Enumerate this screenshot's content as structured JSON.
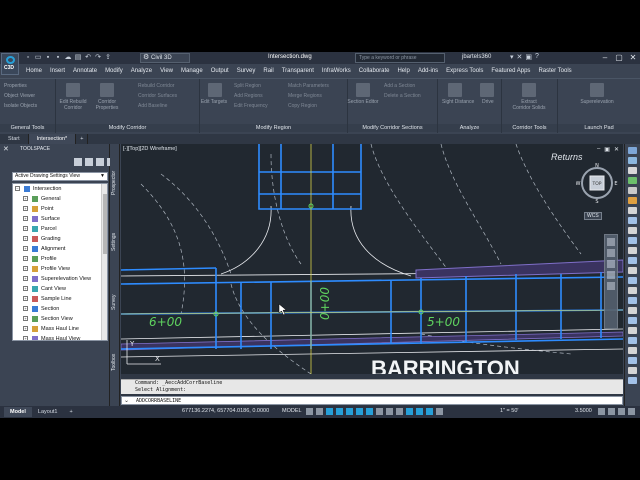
{
  "app": {
    "logo_text": "C3D",
    "workspace": "Civil 3D",
    "doc_title": "Intersection.dwg",
    "search_placeholder": "Type a keyword or phrase",
    "user": "jbartels360"
  },
  "menu": {
    "tabs": [
      "Home",
      "Insert",
      "Annotate",
      "Modify",
      "Analyze",
      "View",
      "Manage",
      "Output",
      "Survey",
      "Rail",
      "Transparent",
      "InfraWorks",
      "Collaborate",
      "Help",
      "Add-ins",
      "Express Tools",
      "Featured Apps",
      "Raster Tools"
    ]
  },
  "ribbon": {
    "general_tools": {
      "title": "General Tools",
      "items": [
        "Properties",
        "Object Viewer",
        "Isolate Objects"
      ]
    },
    "modify_corridor": {
      "title": "Modify Corridor",
      "big1": "Edit Rebuild Corridor",
      "big2": "Corridor Properties",
      "items": [
        "Rebuild Corridor",
        "Corridor Surfaces",
        "Add Baseline"
      ]
    },
    "modify_region": {
      "title": "Modify Region",
      "big1": "Edit Targets",
      "items": [
        "Split Region",
        "Add Regions",
        "Edit Frequency",
        "Match Parameters",
        "Merge Regions",
        "Copy Region"
      ]
    },
    "modify_sections": {
      "title": "Modify Corridor Sections",
      "big1": "Section Editor",
      "items": [
        "Add a Section",
        "Delete a Section"
      ]
    },
    "analyze": {
      "title": "Analyze",
      "items": [
        "Sight Distance",
        "Drive"
      ]
    },
    "corridor_tools": {
      "title": "Corridor Tools",
      "big1": "Extract Corridor Solids"
    },
    "launch_pad": {
      "title": "Launch Pad",
      "big1": "Superelevation"
    }
  },
  "doc_tabs": [
    "Start",
    "Intersection*"
  ],
  "toolspace": {
    "title": "TOOLSPACE",
    "view_select": "Active Drawing Settings View",
    "tree": [
      {
        "label": "Intersection",
        "level": 0,
        "icon": "drawing-icon"
      },
      {
        "label": "General",
        "level": 1,
        "icon": "general-icon"
      },
      {
        "label": "Point",
        "level": 1,
        "icon": "point-icon"
      },
      {
        "label": "Surface",
        "level": 1,
        "icon": "surface-icon"
      },
      {
        "label": "Parcel",
        "level": 1,
        "icon": "parcel-icon"
      },
      {
        "label": "Grading",
        "level": 1,
        "icon": "grading-icon"
      },
      {
        "label": "Alignment",
        "level": 1,
        "icon": "alignment-icon"
      },
      {
        "label": "Profile",
        "level": 1,
        "icon": "profile-icon"
      },
      {
        "label": "Profile View",
        "level": 1,
        "icon": "profile-view-icon"
      },
      {
        "label": "Superelevation View",
        "level": 1,
        "icon": "superelevation-icon"
      },
      {
        "label": "Cant View",
        "level": 1,
        "icon": "cant-icon"
      },
      {
        "label": "Sample Line",
        "level": 1,
        "icon": "sample-line-icon"
      },
      {
        "label": "Section",
        "level": 1,
        "icon": "section-icon"
      },
      {
        "label": "Section View",
        "level": 1,
        "icon": "section-view-icon"
      },
      {
        "label": "Mass Haul Line",
        "level": 1,
        "icon": "mass-haul-icon"
      },
      {
        "label": "Mass Haul View",
        "level": 1,
        "icon": "mass-haul-view-icon"
      }
    ],
    "side_tabs": [
      "Prospector",
      "Settings",
      "Survey",
      "Toolbox"
    ]
  },
  "viewport": {
    "label": "[-][Top][2D Wireframe]",
    "returns_text": "Returns",
    "compass": {
      "n": "N",
      "s": "S",
      "e": "E",
      "w": "W",
      "top": "TOP"
    },
    "wcs": "WCS",
    "station_labels": [
      "6+00",
      "0+00",
      "5+00"
    ],
    "street_text": "BARRINGTON"
  },
  "command": {
    "history": [
      "Command: _AeccAddCorrBaseline",
      "Select Alignment:"
    ],
    "input": "ADDCORRBASELINE"
  },
  "status": {
    "layout_tabs": [
      "Model",
      "Layout1"
    ],
    "coords": "677136.2274, 657704.0186, 0.0000",
    "space": "MODEL",
    "scale": "1\" = 50'",
    "zoom": "3.5000"
  },
  "colors": {
    "background": "#212830",
    "alignment_blue": "#2e8cff",
    "station_green": "#5fd35f",
    "hatch_purple": "#7f6fc8"
  }
}
